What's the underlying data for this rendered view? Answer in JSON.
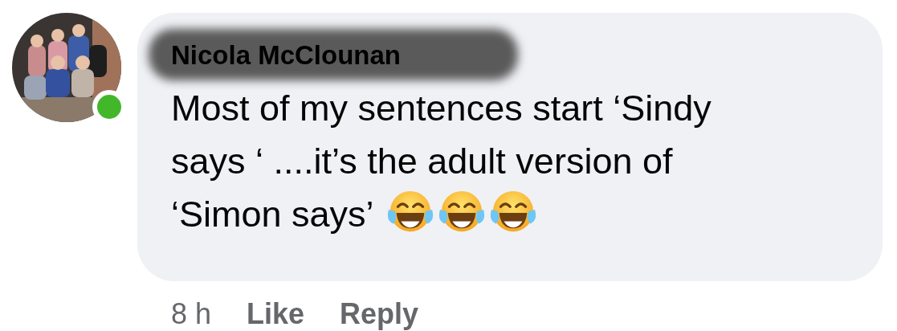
{
  "comment": {
    "author": "Nicola McClounan",
    "author_redacted": true,
    "online": true,
    "lines": [
      "Most of my sentences start ‘Sindy",
      "says ‘ ....it’s the adult version of",
      "‘Simon says’"
    ],
    "emoji": [
      {
        "kind": "tears-of-joy"
      },
      {
        "kind": "tears-of-joy"
      },
      {
        "kind": "tears-of-joy"
      }
    ],
    "time": "8 h",
    "actions": [
      "Like",
      "Reply"
    ]
  }
}
